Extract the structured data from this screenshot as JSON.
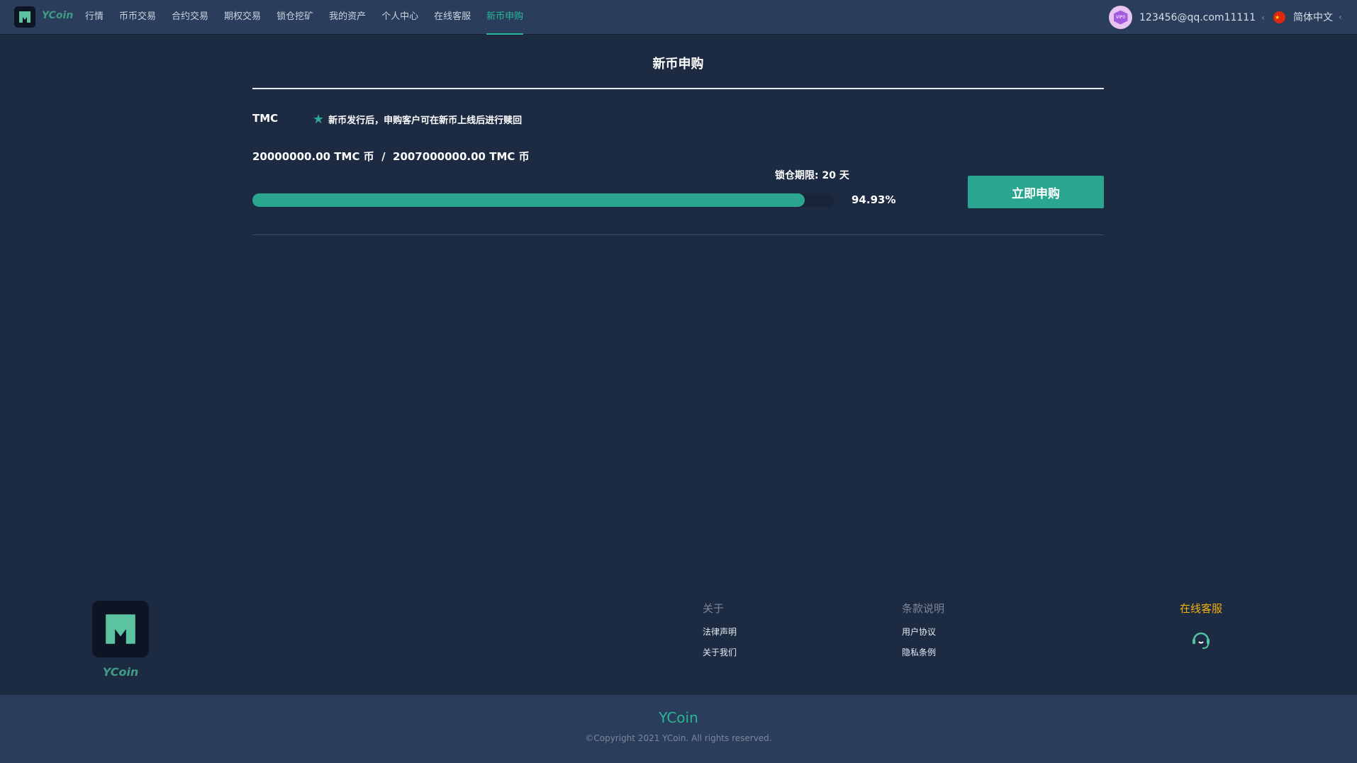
{
  "header": {
    "brand": "YCoin",
    "nav": [
      "行情",
      "币币交易",
      "合约交易",
      "期权交易",
      "锁仓挖矿",
      "我的资产",
      "个人中心",
      "在线客服",
      "新币申购"
    ],
    "active": "新币申购",
    "user_email": "123456@qq.com11111",
    "vip_badge": "VIP0",
    "language": "简体中文"
  },
  "main": {
    "title": "新币申购",
    "coin": "TMC",
    "note": "新币发行后，申购客户可在新币上线后进行赎回",
    "amounts": "20000000.00 TMC 币  /  2007000000.00 TMC 币",
    "lock_period": "锁仓期限: 20 天",
    "progress_percent": 94.93,
    "progress_label": "94.93%",
    "subscribe_button": "立即申购"
  },
  "footer": {
    "brand": "YCoin",
    "about_title": "关于",
    "about_links": [
      "法律声明",
      "关于我们"
    ],
    "terms_title": "条款说明",
    "terms_links": [
      "用户协议",
      "隐私条例"
    ],
    "service_title": "在线客服",
    "bottom_brand": "YCoin",
    "copyright": "©Copyright 2021 YCoin. All rights reserved."
  },
  "colors": {
    "accent": "#2aa690",
    "bg": "#1c2a42",
    "header": "#2a3e5b",
    "service": "#f2b20c"
  }
}
